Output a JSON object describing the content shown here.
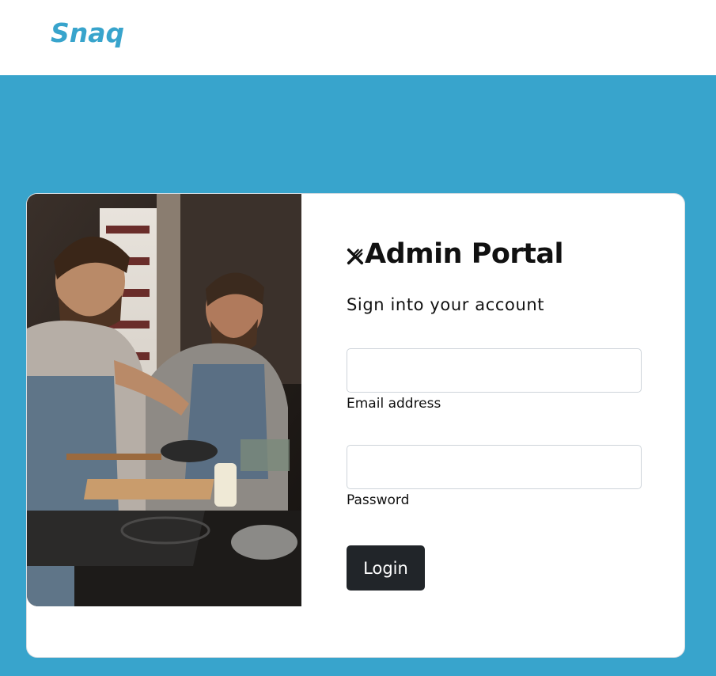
{
  "header": {
    "brand": "Snaq",
    "brand_color": "#38a4cc"
  },
  "hero": {
    "background_color": "#38a4cc"
  },
  "login_card": {
    "image_alt": "Two chefs cooking in a restaurant kitchen",
    "title_icon": "utensils-icon",
    "title": "Admin Portal",
    "subtitle": "Sign into your account",
    "email": {
      "value": "",
      "label": "Email address"
    },
    "password": {
      "value": "",
      "label": "Password"
    },
    "login_label": "Login",
    "button_color": "#212529"
  }
}
